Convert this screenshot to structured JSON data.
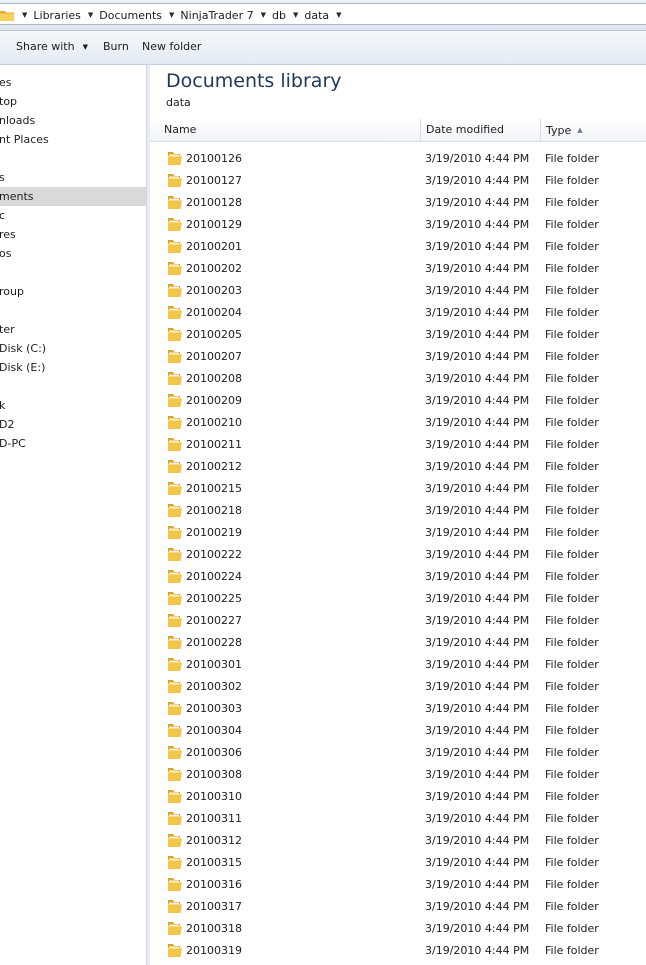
{
  "address": {
    "icon": "folder-icon",
    "crumbs": [
      "Libraries",
      "Documents",
      "NinjaTrader 7",
      "db",
      "data"
    ]
  },
  "toolbar": {
    "share_label": "Share with",
    "burn_label": "Burn",
    "new_folder_label": "New folder"
  },
  "nav": {
    "items": [
      {
        "label": "es"
      },
      {
        "label": "top"
      },
      {
        "label": "nloads"
      },
      {
        "label": "nt Places"
      },
      {
        "label": "s"
      },
      {
        "label": "ments",
        "selected": true
      },
      {
        "label": "c"
      },
      {
        "label": "res"
      },
      {
        "label": "os"
      },
      {
        "label": "roup"
      },
      {
        "label": "ter"
      },
      {
        "label": " Disk (C:)"
      },
      {
        "label": " Disk (E:)"
      },
      {
        "label": "k"
      },
      {
        "label": "D2"
      },
      {
        "label": "D-PC"
      }
    ]
  },
  "library": {
    "title": "Documents library",
    "subtitle": "data"
  },
  "columns": {
    "name": "Name",
    "date": "Date modified",
    "type": "Type"
  },
  "files": [
    {
      "name": "20100126",
      "date": "3/19/2010 4:44 PM",
      "type": "File folder"
    },
    {
      "name": "20100127",
      "date": "3/19/2010 4:44 PM",
      "type": "File folder"
    },
    {
      "name": "20100128",
      "date": "3/19/2010 4:44 PM",
      "type": "File folder"
    },
    {
      "name": "20100129",
      "date": "3/19/2010 4:44 PM",
      "type": "File folder"
    },
    {
      "name": "20100201",
      "date": "3/19/2010 4:44 PM",
      "type": "File folder"
    },
    {
      "name": "20100202",
      "date": "3/19/2010 4:44 PM",
      "type": "File folder"
    },
    {
      "name": "20100203",
      "date": "3/19/2010 4:44 PM",
      "type": "File folder"
    },
    {
      "name": "20100204",
      "date": "3/19/2010 4:44 PM",
      "type": "File folder"
    },
    {
      "name": "20100205",
      "date": "3/19/2010 4:44 PM",
      "type": "File folder"
    },
    {
      "name": "20100207",
      "date": "3/19/2010 4:44 PM",
      "type": "File folder"
    },
    {
      "name": "20100208",
      "date": "3/19/2010 4:44 PM",
      "type": "File folder"
    },
    {
      "name": "20100209",
      "date": "3/19/2010 4:44 PM",
      "type": "File folder"
    },
    {
      "name": "20100210",
      "date": "3/19/2010 4:44 PM",
      "type": "File folder"
    },
    {
      "name": "20100211",
      "date": "3/19/2010 4:44 PM",
      "type": "File folder"
    },
    {
      "name": "20100212",
      "date": "3/19/2010 4:44 PM",
      "type": "File folder"
    },
    {
      "name": "20100215",
      "date": "3/19/2010 4:44 PM",
      "type": "File folder"
    },
    {
      "name": "20100218",
      "date": "3/19/2010 4:44 PM",
      "type": "File folder"
    },
    {
      "name": "20100219",
      "date": "3/19/2010 4:44 PM",
      "type": "File folder"
    },
    {
      "name": "20100222",
      "date": "3/19/2010 4:44 PM",
      "type": "File folder"
    },
    {
      "name": "20100224",
      "date": "3/19/2010 4:44 PM",
      "type": "File folder"
    },
    {
      "name": "20100225",
      "date": "3/19/2010 4:44 PM",
      "type": "File folder"
    },
    {
      "name": "20100227",
      "date": "3/19/2010 4:44 PM",
      "type": "File folder"
    },
    {
      "name": "20100228",
      "date": "3/19/2010 4:44 PM",
      "type": "File folder"
    },
    {
      "name": "20100301",
      "date": "3/19/2010 4:44 PM",
      "type": "File folder"
    },
    {
      "name": "20100302",
      "date": "3/19/2010 4:44 PM",
      "type": "File folder"
    },
    {
      "name": "20100303",
      "date": "3/19/2010 4:44 PM",
      "type": "File folder"
    },
    {
      "name": "20100304",
      "date": "3/19/2010 4:44 PM",
      "type": "File folder"
    },
    {
      "name": "20100306",
      "date": "3/19/2010 4:44 PM",
      "type": "File folder"
    },
    {
      "name": "20100308",
      "date": "3/19/2010 4:44 PM",
      "type": "File folder"
    },
    {
      "name": "20100310",
      "date": "3/19/2010 4:44 PM",
      "type": "File folder"
    },
    {
      "name": "20100311",
      "date": "3/19/2010 4:44 PM",
      "type": "File folder"
    },
    {
      "name": "20100312",
      "date": "3/19/2010 4:44 PM",
      "type": "File folder"
    },
    {
      "name": "20100315",
      "date": "3/19/2010 4:44 PM",
      "type": "File folder"
    },
    {
      "name": "20100316",
      "date": "3/19/2010 4:44 PM",
      "type": "File folder"
    },
    {
      "name": "20100317",
      "date": "3/19/2010 4:44 PM",
      "type": "File folder"
    },
    {
      "name": "20100318",
      "date": "3/19/2010 4:44 PM",
      "type": "File folder"
    },
    {
      "name": "20100319",
      "date": "3/19/2010 4:44 PM",
      "type": "File folder"
    }
  ],
  "colors": {
    "folder": "#f3c54a",
    "selected_nav": "#d9d9d9",
    "title": "#1e395b"
  }
}
